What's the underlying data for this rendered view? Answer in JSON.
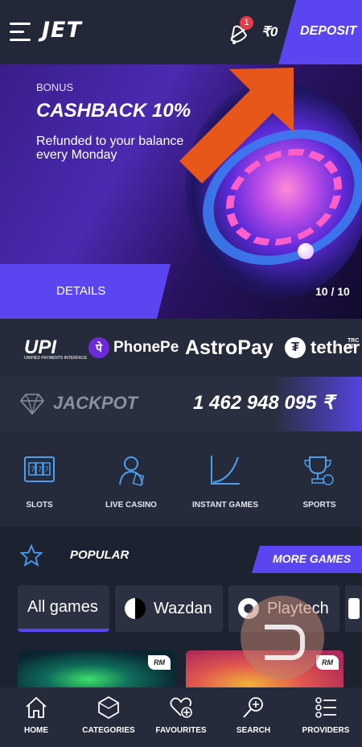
{
  "header": {
    "logo": "JET",
    "notification_count": "1",
    "balance": "₹0",
    "deposit_label": "DEPOSIT"
  },
  "banner": {
    "bonus_label": "BONUS",
    "title": "CASHBACK 10%",
    "subtitle": "Refunded to your balance every Monday",
    "details_label": "DETAILS",
    "counter": "10 / 10"
  },
  "payments": {
    "items": [
      "UPI",
      "PhonePe",
      "AstroPay",
      "tether"
    ],
    "upi_tagline": "UNIFIED PAYMENTS INTERFACE",
    "tether_tag": "TRC 20"
  },
  "jackpot": {
    "label": "JACKPOT",
    "amount": "1 462 948 095 ₹"
  },
  "categories": {
    "items": [
      {
        "label": "SLOTS",
        "icon": "slots-icon"
      },
      {
        "label": "LIVE CASINO",
        "icon": "live-casino-icon"
      },
      {
        "label": "INSTANT GAMES",
        "icon": "instant-games-icon"
      },
      {
        "label": "SPORTS",
        "icon": "sports-icon"
      }
    ]
  },
  "popular": {
    "title": "POPULAR",
    "more_label": "MORE GAMES",
    "chips": [
      {
        "label": "All games",
        "active": true
      },
      {
        "label": "Wazdan",
        "active": false
      },
      {
        "label": "Playtech",
        "active": false
      }
    ],
    "provider_badge": "RM"
  },
  "bottom_nav": {
    "items": [
      {
        "label": "HOME",
        "icon": "home-icon",
        "active": true
      },
      {
        "label": "CATEGORIES",
        "icon": "categories-icon"
      },
      {
        "label": "FAVOURITES",
        "icon": "favourites-icon"
      },
      {
        "label": "SEARCH",
        "icon": "search-icon"
      },
      {
        "label": "PROVIDERS",
        "icon": "providers-icon"
      }
    ]
  },
  "colors": {
    "accent": "#5a45f0",
    "background": "#1f2433",
    "arrow": "#e8571a"
  }
}
